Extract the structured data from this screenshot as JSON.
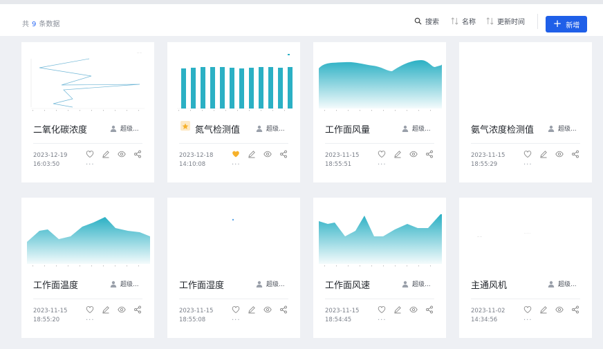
{
  "header": {
    "total_prefix": "共",
    "total_count": "9",
    "total_suffix": "条数据",
    "search_label": "搜索",
    "name_sort_label": "名称",
    "time_sort_label": "更新时间",
    "new_label": "新增"
  },
  "cards": [
    {
      "title": "二氧化碳浓度",
      "author": "超级...",
      "date": "2023-12-19",
      "time": "16:03:50",
      "favorite": false,
      "thumb": "line-vertical",
      "more": "···"
    },
    {
      "title": "氮气检测值",
      "author": "超级...",
      "date": "2023-12-18",
      "time": "14:10:08",
      "favorite": true,
      "thumb": "bar",
      "more": "···"
    },
    {
      "title": "工作面风量",
      "author": "超级...",
      "date": "2023-11-15",
      "time": "18:55:51",
      "favorite": false,
      "thumb": "area-1",
      "more": "···"
    },
    {
      "title": "氨气浓度检测值",
      "author": "超级...",
      "date": "2023-11-15",
      "time": "18:55:29",
      "favorite": false,
      "thumb": "empty",
      "more": "···"
    },
    {
      "title": "工作面温度",
      "author": "超级...",
      "date": "2023-11-15",
      "time": "18:55:20",
      "favorite": false,
      "thumb": "area-2",
      "more": "···"
    },
    {
      "title": "工作面湿度",
      "author": "超级...",
      "date": "2023-11-15",
      "time": "18:55:08",
      "favorite": false,
      "thumb": "dot",
      "more": "···"
    },
    {
      "title": "工作面风速",
      "author": "超级...",
      "date": "2023-11-15",
      "time": "18:54:45",
      "favorite": false,
      "thumb": "area-3",
      "more": "···"
    },
    {
      "title": "主通风机",
      "author": "超级...",
      "date": "2023-11-02",
      "time": "14:34:56",
      "favorite": false,
      "thumb": "sparse",
      "more": "···"
    }
  ],
  "colors": {
    "accent": "#1f5fe8",
    "chart": "#2bb0c4",
    "favorite": "#f6b12b"
  }
}
